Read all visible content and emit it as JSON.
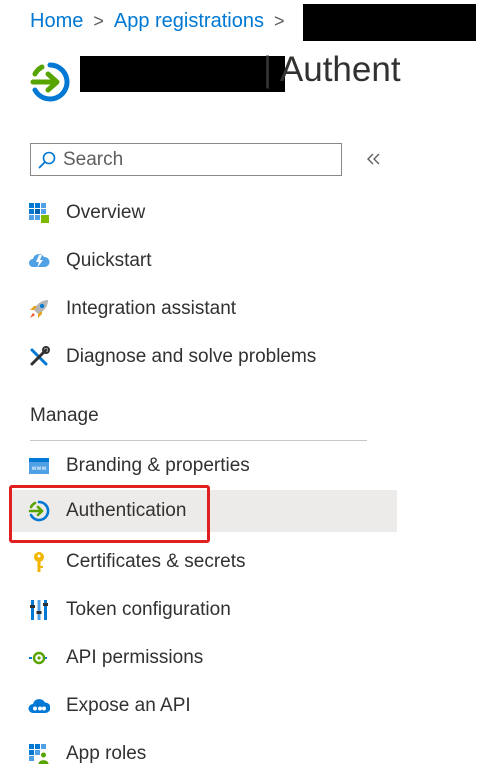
{
  "breadcrumb": {
    "home": "Home",
    "app_registrations": "App registrations",
    "separator": ">"
  },
  "page": {
    "title": "| Authent"
  },
  "search": {
    "placeholder": "Search",
    "collapse_symbol": "«"
  },
  "nav": {
    "top_items": [
      {
        "label": "Overview",
        "icon": "overview-grid-icon"
      },
      {
        "label": "Quickstart",
        "icon": "quickstart-cloud-icon"
      },
      {
        "label": "Integration assistant",
        "icon": "rocket-icon"
      },
      {
        "label": "Diagnose and solve problems",
        "icon": "wrench-screwdriver-icon"
      }
    ],
    "manage_header": "Manage",
    "manage_items": [
      {
        "label": "Branding & properties",
        "icon": "branding-window-icon"
      },
      {
        "label": "Authentication",
        "icon": "authentication-arrow-icon",
        "selected": true
      },
      {
        "label": "Certificates & secrets",
        "icon": "key-icon"
      },
      {
        "label": "Token configuration",
        "icon": "token-bars-icon"
      },
      {
        "label": "API permissions",
        "icon": "api-permissions-icon"
      },
      {
        "label": "Expose an API",
        "icon": "expose-api-cloud-icon"
      },
      {
        "label": "App roles",
        "icon": "app-roles-icon"
      }
    ]
  },
  "colors": {
    "link": "#0078d4",
    "text": "#323130",
    "selected_bg": "#edebe9",
    "highlight": "#e02020",
    "auth_green": "#57a300",
    "auth_blue": "#0078d4"
  }
}
